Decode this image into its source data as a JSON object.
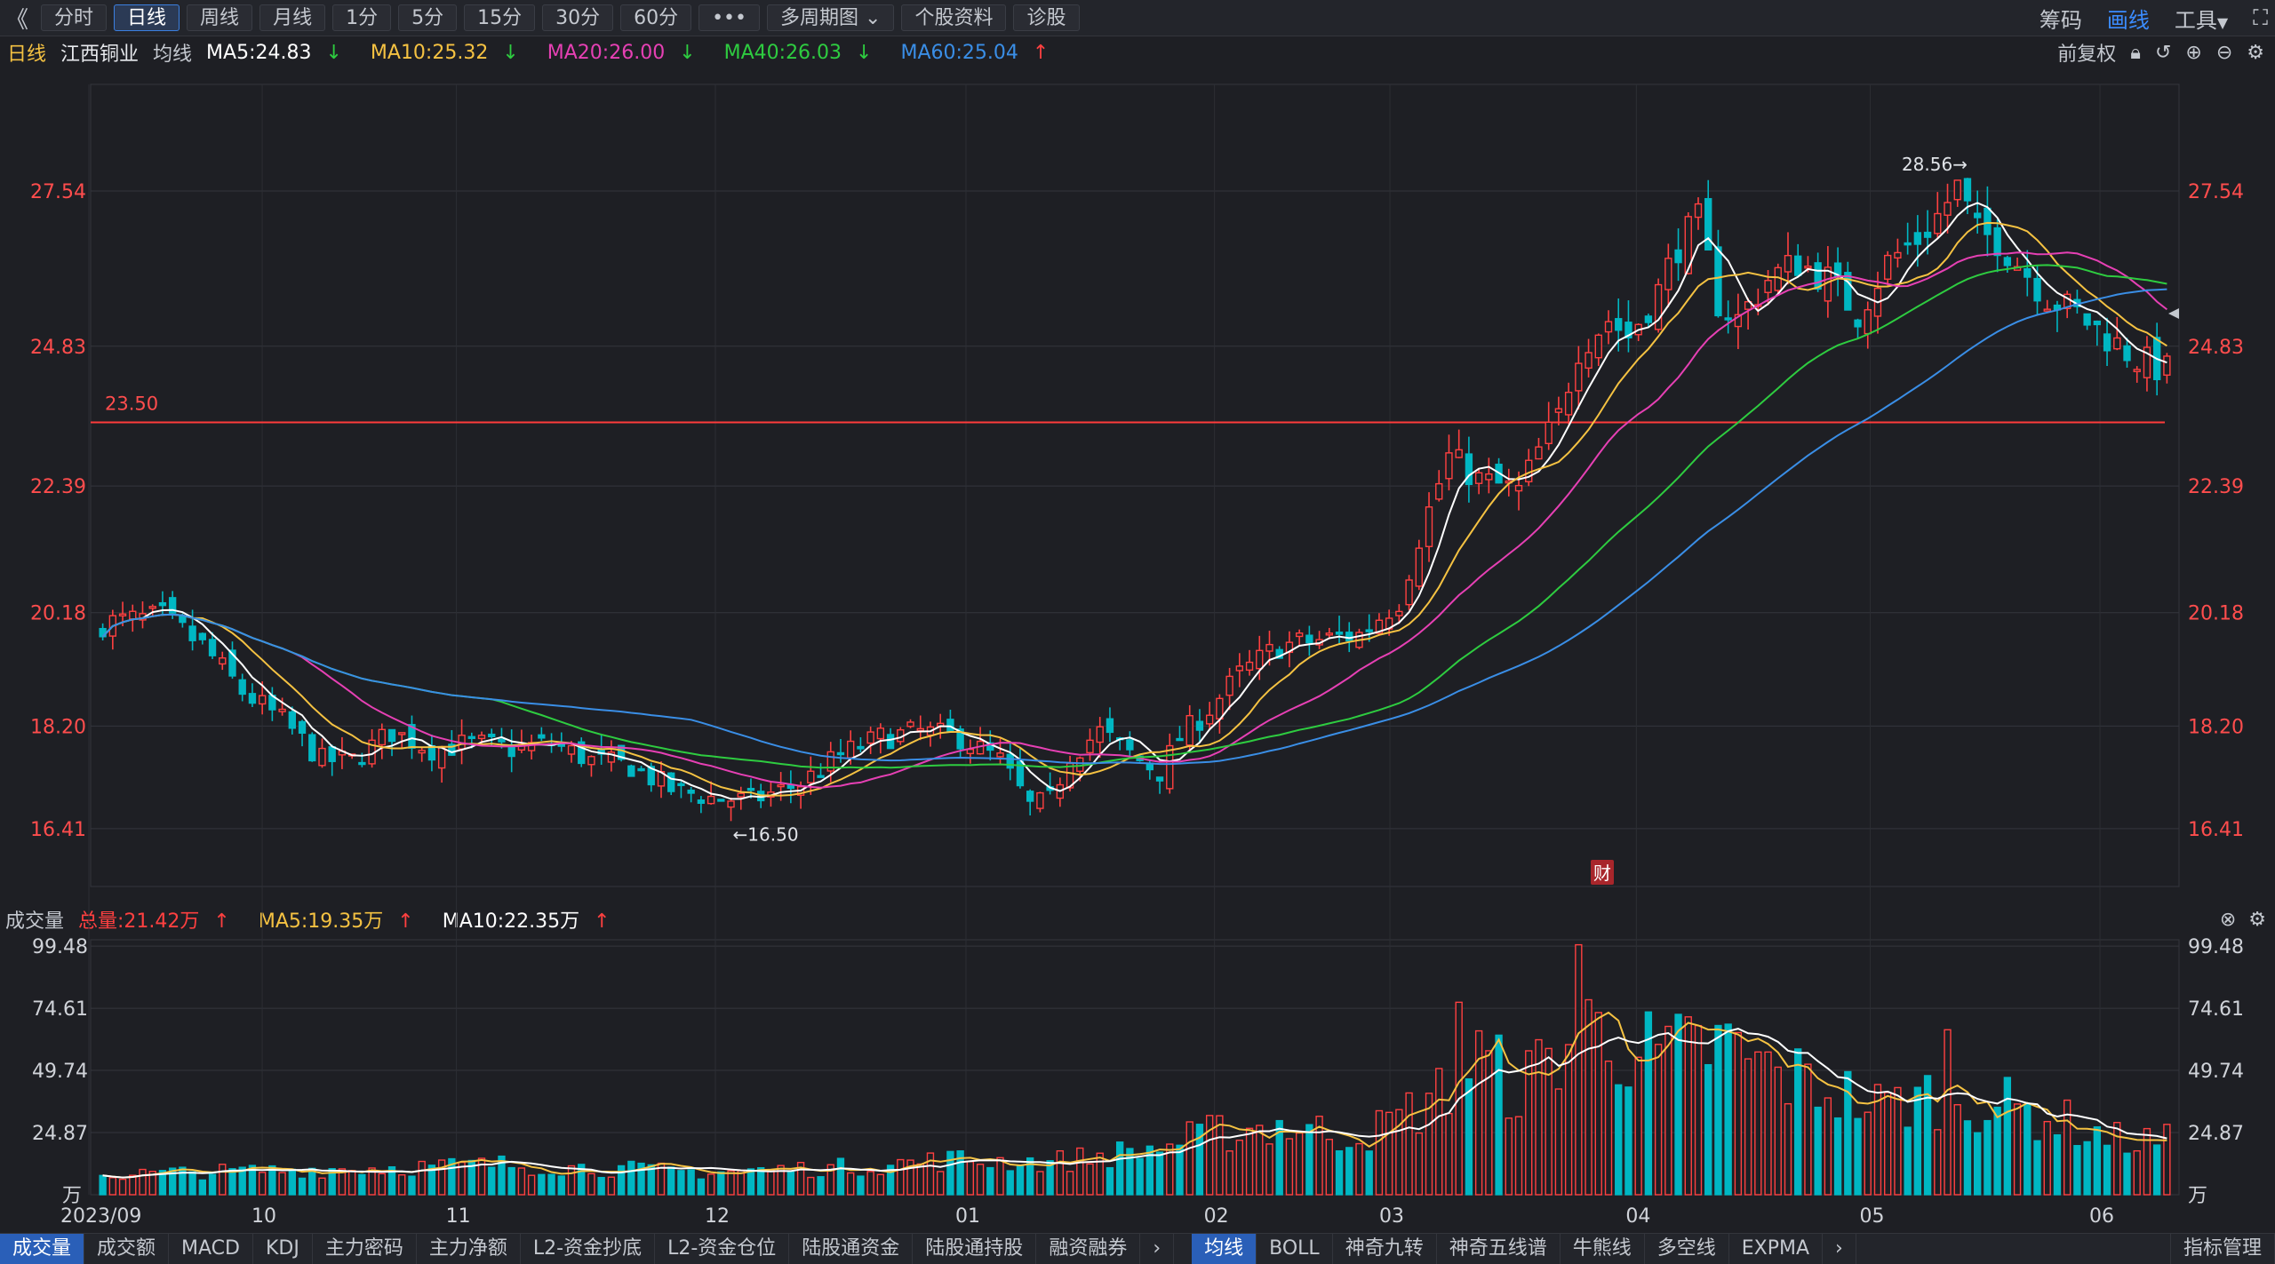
{
  "toolbar": {
    "back_icon": "chevron-left-icon",
    "periods": [
      "分时",
      "日线",
      "周线",
      "月线",
      "1分",
      "5分",
      "15分",
      "30分",
      "60分"
    ],
    "active_period": "日线",
    "more_label": "•••",
    "multi_label": "多周期图",
    "profile_label": "个股资料",
    "diagnose_label": "诊股",
    "right": {
      "chip": "筹码",
      "draw": "画线",
      "tools": "工具"
    }
  },
  "info": {
    "period": "日线",
    "stock": "江西铜业",
    "indicator": "均线",
    "ma5": "MA5:24.83",
    "ma10": "MA10:25.32",
    "ma20": "MA20:26.00",
    "ma40": "MA40:26.03",
    "ma60": "MA60:25.04",
    "adjust": "前复权"
  },
  "volume_info": {
    "label": "成交量",
    "total": "总量:21.42万",
    "ma5": "MA5:19.35万",
    "ma10": "MA10:22.35万"
  },
  "bottom_tabs": {
    "left": [
      "成交量",
      "成交额",
      "MACD",
      "KDJ",
      "主力密码",
      "主力净额",
      "L2-资金抄底",
      "L2-资金仓位",
      "陆股通资金",
      "陆股通持股",
      "融资融券"
    ],
    "left_active": "成交量",
    "right": [
      "均线",
      "BOLL",
      "神奇九转",
      "神奇五线谱",
      "牛熊线",
      "多空线",
      "EXPMA"
    ],
    "right_active": "均线",
    "manage": "指标管理"
  },
  "chart_data": [
    {
      "type": "candlestick",
      "ylim": [
        15.4,
        29.4
      ],
      "ticks": [
        "27.54",
        "24.83",
        "22.39",
        "20.18",
        "18.20",
        "16.41"
      ],
      "x_labels": [
        {
          "label": "2023/09",
          "pos": 0.0
        },
        {
          "label": "10",
          "pos": 0.083
        },
        {
          "label": "11",
          "pos": 0.176
        },
        {
          "label": "12",
          "pos": 0.3
        },
        {
          "label": "01",
          "pos": 0.42
        },
        {
          "label": "02",
          "pos": 0.539
        },
        {
          "label": "03",
          "pos": 0.623
        },
        {
          "label": "04",
          "pos": 0.741
        },
        {
          "label": "05",
          "pos": 0.853
        },
        {
          "label": "06",
          "pos": 0.963
        }
      ],
      "ref_line": {
        "value": 23.5,
        "label": "23.50"
      },
      "max_label": "28.56→",
      "min_label": "←16.50",
      "badge": "财",
      "colors": {
        "up": "#ff4040",
        "down": "#00b7c3",
        "ma5": "#ffffff",
        "ma10": "#f5c242",
        "ma20": "#e640b4",
        "ma40": "#2ecc40",
        "ma60": "#3a8ee6"
      },
      "anchors": [
        [
          0,
          20.0
        ],
        [
          6,
          20.1
        ],
        [
          10,
          19.6
        ],
        [
          14,
          18.8
        ],
        [
          18,
          18.3
        ],
        [
          22,
          17.6
        ],
        [
          25,
          17.6
        ],
        [
          29,
          18.1
        ],
        [
          33,
          17.8
        ],
        [
          37,
          17.9
        ],
        [
          41,
          17.8
        ],
        [
          45,
          17.9
        ],
        [
          49,
          17.6
        ],
        [
          53,
          17.5
        ],
        [
          57,
          17.1
        ],
        [
          61,
          16.95
        ],
        [
          65,
          16.9
        ],
        [
          70,
          17.2
        ],
        [
          74,
          17.7
        ],
        [
          78,
          18.0
        ],
        [
          82,
          18.1
        ],
        [
          86,
          18.0
        ],
        [
          90,
          17.6
        ],
        [
          93,
          16.8
        ],
        [
          95,
          16.9
        ],
        [
          97,
          17.7
        ],
        [
          100,
          18.1
        ],
        [
          104,
          17.6
        ],
        [
          106,
          17.4
        ],
        [
          108,
          18.0
        ],
        [
          111,
          18.5
        ],
        [
          114,
          19.1
        ],
        [
          118,
          19.6
        ],
        [
          122,
          19.7
        ],
        [
          126,
          19.8
        ],
        [
          130,
          20.4
        ],
        [
          132,
          21.5
        ],
        [
          135,
          22.9
        ],
        [
          138,
          22.5
        ],
        [
          142,
          22.3
        ],
        [
          144,
          23.0
        ],
        [
          146,
          23.6
        ],
        [
          148,
          24.8
        ],
        [
          151,
          25.3
        ],
        [
          153,
          25.0
        ],
        [
          156,
          25.8
        ],
        [
          158,
          26.6
        ],
        [
          160,
          27.0
        ],
        [
          162,
          25.6
        ],
        [
          164,
          25.3
        ],
        [
          167,
          26.0
        ],
        [
          170,
          26.3
        ],
        [
          173,
          26.0
        ],
        [
          176,
          25.4
        ],
        [
          179,
          26.3
        ],
        [
          182,
          26.7
        ],
        [
          184,
          27.1
        ],
        [
          186,
          27.6
        ],
        [
          188,
          26.8
        ],
        [
          190,
          26.7
        ],
        [
          192,
          26.3
        ],
        [
          195,
          25.7
        ],
        [
          198,
          25.4
        ],
        [
          201,
          25.0
        ],
        [
          204,
          24.6
        ],
        [
          207,
          24.4
        ]
      ],
      "ma_periods": [
        5,
        10,
        20,
        40,
        60
      ]
    },
    {
      "type": "bar",
      "name": "成交量",
      "unit": "万",
      "ylim": [
        0,
        102
      ],
      "ticks": [
        "99.48",
        "74.61",
        "49.74",
        "24.87"
      ],
      "zero_label": "万",
      "anchors": [
        [
          0,
          8
        ],
        [
          20,
          10
        ],
        [
          40,
          12
        ],
        [
          60,
          9
        ],
        [
          75,
          11
        ],
        [
          85,
          14
        ],
        [
          95,
          13
        ],
        [
          105,
          18
        ],
        [
          112,
          25
        ],
        [
          118,
          28
        ],
        [
          124,
          24
        ],
        [
          128,
          26
        ],
        [
          134,
          40
        ],
        [
          138,
          55
        ],
        [
          142,
          42
        ],
        [
          146,
          58
        ],
        [
          150,
          66
        ],
        [
          156,
          54
        ],
        [
          162,
          60
        ],
        [
          168,
          48
        ],
        [
          172,
          44
        ],
        [
          178,
          35
        ],
        [
          184,
          40
        ],
        [
          190,
          36
        ],
        [
          196,
          30
        ],
        [
          202,
          22
        ],
        [
          207,
          21
        ]
      ],
      "spikes": [
        [
          136,
          77
        ],
        [
          148,
          100
        ],
        [
          149,
          78
        ],
        [
          185,
          66
        ]
      ]
    }
  ]
}
